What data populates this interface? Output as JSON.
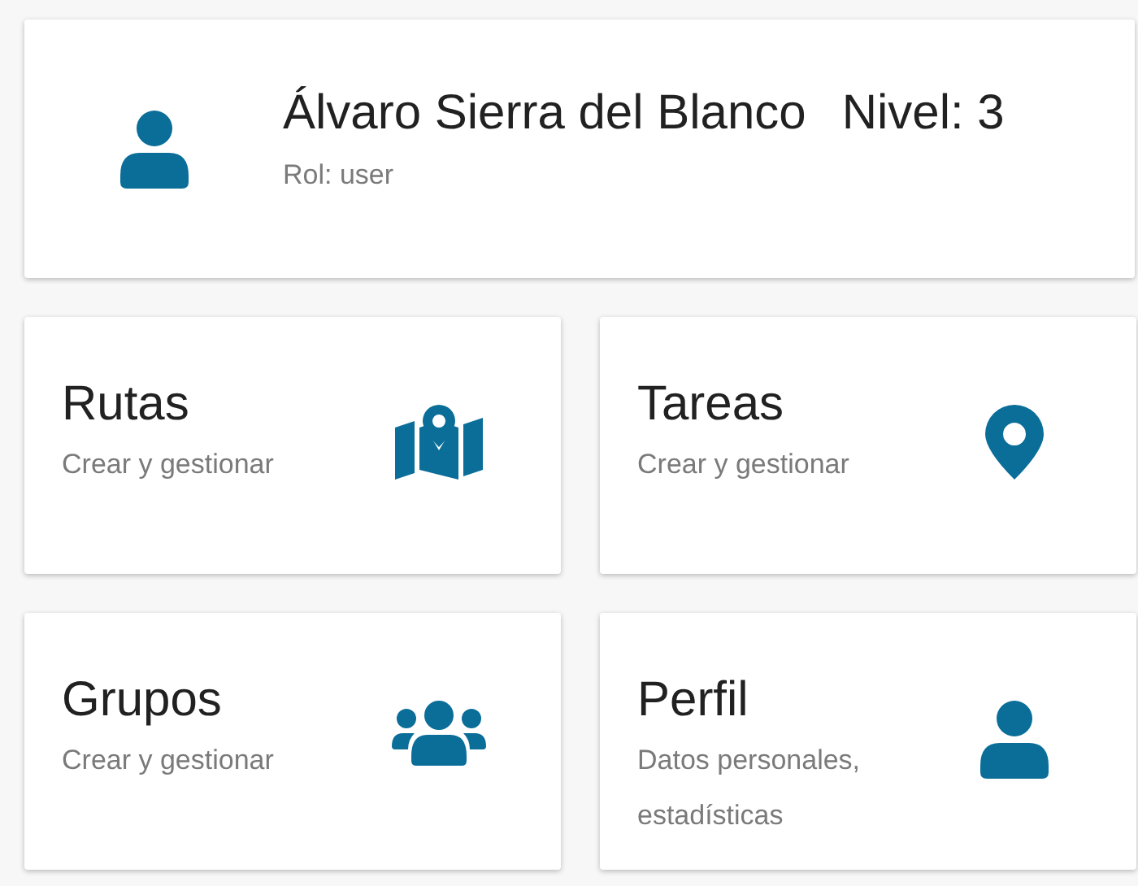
{
  "user": {
    "name": "Álvaro Sierra del Blanco",
    "level": "Nivel: 3",
    "role": "Rol: user"
  },
  "cards": [
    {
      "kind": "map",
      "title": "Rutas",
      "subtitle": "Crear y gestionar"
    },
    {
      "kind": "pin",
      "title": "Tareas",
      "subtitle": "Crear y gestionar"
    },
    {
      "kind": "group",
      "title": "Grupos",
      "subtitle": "Crear y gestionar"
    },
    {
      "kind": "person",
      "title": "Perfil",
      "subtitle": "Datos personales, estadísticas"
    }
  ]
}
